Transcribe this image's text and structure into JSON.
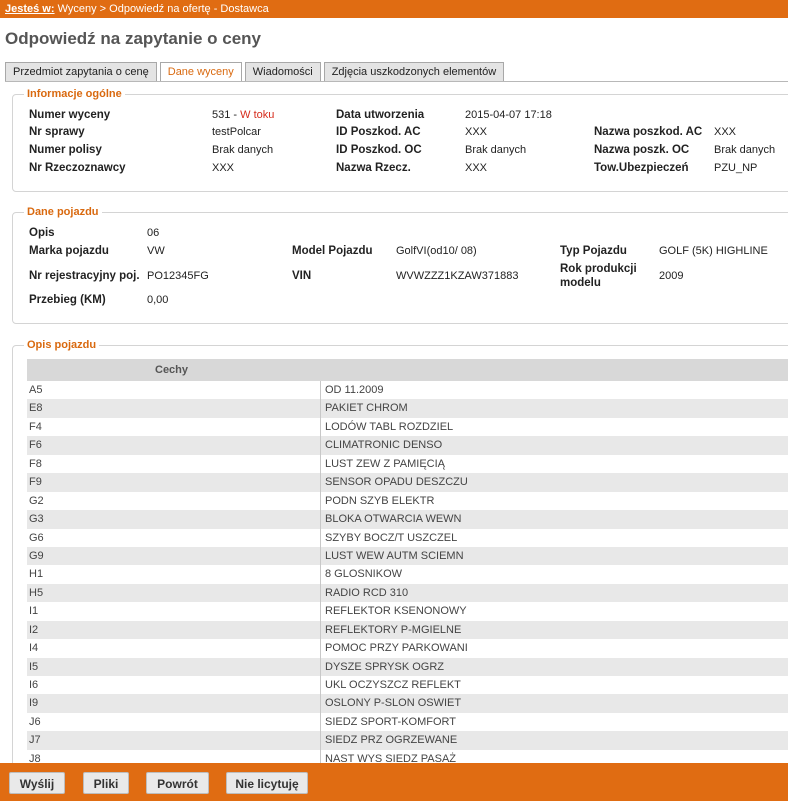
{
  "breadcrumb": {
    "here_label": "Jesteś w:",
    "path": "Wyceny > Odpowiedź na ofertę - Dostawca"
  },
  "page_title": "Odpowiedź na zapytanie o ceny",
  "tabs": [
    {
      "label": "Przedmiot zapytania o cenę",
      "active": false
    },
    {
      "label": "Dane wyceny",
      "active": true
    },
    {
      "label": "Wiadomości",
      "active": false
    },
    {
      "label": "Zdjęcia uszkodzonych elementów",
      "active": false
    }
  ],
  "general": {
    "legend": "Informacje ogólne",
    "quote_number_label": "Numer wyceny",
    "quote_number": "531",
    "quote_sep": " - ",
    "quote_status": "W toku",
    "case_label": "Nr sprawy",
    "case": "testPolcar",
    "policy_label": "Numer polisy",
    "policy": "Brak danych",
    "appraiser_label": "Nr Rzeczoznawcy",
    "appraiser": "XXX",
    "created_label": "Data utworzenia",
    "created": "2015-04-07 17:18",
    "id_ac_label": "ID Poszkod. AC",
    "id_ac": "XXX",
    "id_oc_label": "ID Poszkod. OC",
    "id_oc": "Brak danych",
    "appraiser_name_label": "Nazwa Rzecz.",
    "appraiser_name": "XXX",
    "name_ac_label": "Nazwa poszkod. AC",
    "name_ac": "XXX",
    "name_oc_label": "Nazwa poszk. OC",
    "name_oc": "Brak danych",
    "insurer_label": "Tow.Ubezpieczeń",
    "insurer": "PZU_NP"
  },
  "vehicle": {
    "legend": "Dane pojazdu",
    "desc_label": "Opis",
    "desc": "06",
    "make_label": "Marka pojazdu",
    "make": "VW",
    "model_label": "Model Pojazdu",
    "model": "GolfVI(od10/ 08)",
    "type_label": "Typ Pojazdu",
    "type": "GOLF (5K) HIGHLINE",
    "reg_label": "Nr rejestracyjny poj.",
    "reg": "PO12345FG",
    "vin_label": "VIN",
    "vin": "WVWZZZ1KZAW371883",
    "year_label_1": "Rok produkcji",
    "year_label_2": "modelu",
    "year": "2009",
    "mileage_label": "Przebieg (KM)",
    "mileage": "0,00"
  },
  "features": {
    "legend": "Opis pojazdu",
    "column_header": "Cechy",
    "rows": [
      {
        "code": "A5",
        "desc": "OD 11.2009"
      },
      {
        "code": "E8",
        "desc": "PAKIET CHROM"
      },
      {
        "code": "F4",
        "desc": "LODÓW TABL ROZDZIEL"
      },
      {
        "code": "F6",
        "desc": "CLIMATRONIC DENSO"
      },
      {
        "code": "F8",
        "desc": "LUST ZEW Z PAMIĘCIĄ"
      },
      {
        "code": "F9",
        "desc": "SENSOR OPADU DESZCZU"
      },
      {
        "code": "G2",
        "desc": "PODN SZYB ELEKTR"
      },
      {
        "code": "G3",
        "desc": "BLOKA OTWARCIA WEWN"
      },
      {
        "code": "G6",
        "desc": "SZYBY BOCZ/T USZCZEL"
      },
      {
        "code": "G9",
        "desc": "LUST WEW AUTM SCIEMN"
      },
      {
        "code": "H1",
        "desc": "8 GLOSNIKOW"
      },
      {
        "code": "H5",
        "desc": "RADIO RCD 310"
      },
      {
        "code": "I1",
        "desc": "REFLEKTOR KSENONOWY"
      },
      {
        "code": "I2",
        "desc": "REFLEKTORY P-MGIELNE"
      },
      {
        "code": "I4",
        "desc": "POMOC PRZY PARKOWANI"
      },
      {
        "code": "I5",
        "desc": "DYSZE SPRYSK OGRZ"
      },
      {
        "code": "I6",
        "desc": "UKL OCZYSZCZ REFLEKT"
      },
      {
        "code": "I9",
        "desc": "OSLONY P-SLON OSWIET"
      },
      {
        "code": "J6",
        "desc": "SIEDZ SPORT-KOMFORT"
      },
      {
        "code": "J7",
        "desc": "SIEDZ PRZ OGRZEWANE"
      },
      {
        "code": "J8",
        "desc": "NAST WYS SIEDZ PASAŻ"
      }
    ]
  },
  "footer": {
    "send_label": "Wyślij",
    "files_label": "Pliki",
    "back_label": "Powrót",
    "nobid_label": "Nie licytuję"
  }
}
